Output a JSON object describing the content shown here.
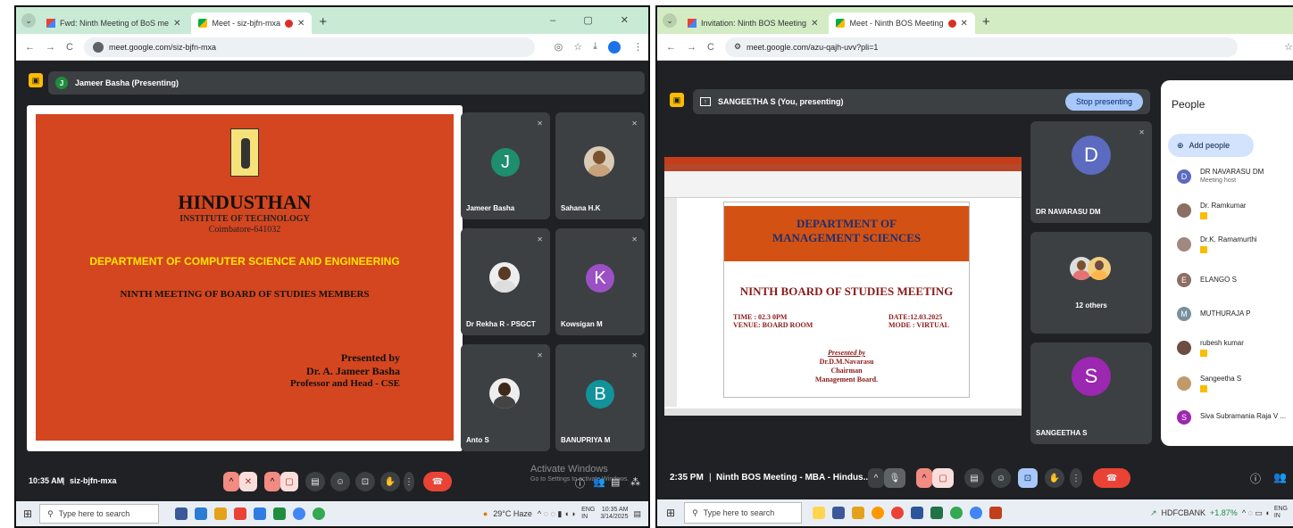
{
  "left": {
    "tabs": [
      {
        "label": "Fwd: Ninth Meeting of BoS me"
      },
      {
        "label": "Meet - siz-bjfn-mxa"
      }
    ],
    "url": "meet.google.com/siz-bjfn-mxa",
    "presenter": "Jameer Basha (Presenting)",
    "presenter_initial": "J",
    "slide": {
      "college": "HINDUSTHAN",
      "institute": "INSTITUTE OF TECHNOLOGY",
      "city": "Coimbatore-641032",
      "department": "DEPARTMENT OF COMPUTER SCIENCE AND ENGINEERING",
      "meeting": "NINTH MEETING OF BOARD OF STUDIES MEMBERS",
      "presented_by": "Presented by",
      "presenter_name": "Dr. A. Jameer Basha",
      "presenter_role": "Professor and Head - CSE",
      "background_color": "#d4461f"
    },
    "participants": [
      {
        "name": "Jameer Basha",
        "initial": "J",
        "color": "#1e8e6e",
        "type": "initial"
      },
      {
        "name": "Sahana H.K",
        "initial": "",
        "color": "#d9cbb6",
        "type": "photo"
      },
      {
        "name": "Dr Rekha R - PSGCT",
        "initial": "",
        "color": "#e8e8e8",
        "type": "photo"
      },
      {
        "name": "Kowsigan M",
        "initial": "K",
        "color": "#9b51c4",
        "type": "initial"
      },
      {
        "name": "Anto S",
        "initial": "",
        "color": "#e8e8e8",
        "type": "photo"
      },
      {
        "name": "BANUPRIYA M",
        "initial": "B",
        "color": "#12939a",
        "type": "initial"
      }
    ],
    "time": "10:35 AM",
    "meeting_code": "siz-bjfn-mxa",
    "activate_title": "Activate Windows",
    "activate_sub": "Go to Settings to activate Windows.",
    "taskbar": {
      "search_placeholder": "Type here to search",
      "weather": "29°C Haze",
      "lang": "ENG",
      "region": "IN",
      "clock_time": "10:35 AM",
      "clock_date": "3/14/2025"
    }
  },
  "right": {
    "tabs": [
      {
        "label": "Invitation: Ninth BOS Meeting"
      },
      {
        "label": "Meet - Ninth BOS Meeting"
      }
    ],
    "url": "meet.google.com/azu-qajh-uvv?pli=1",
    "presenter": "SANGEETHA S (You, presenting)",
    "stop_presenting": "Stop presenting",
    "slide": {
      "department_line1": "DEPARTMENT OF",
      "department_line2": "MANAGEMENT SCIENCES",
      "meeting": "NINTH BOARD OF STUDIES MEETING",
      "time": "TIME : 02.3 0PM",
      "venue": "VENUE: BOARD ROOM",
      "date": "DATE:12.03.2025",
      "mode": "MODE : VIRTUAL",
      "presented_by": "Presented by",
      "presenter_name": "Dr.D.M.Navarasu",
      "presenter_role": "Chairman",
      "presenter_board": "Management Board."
    },
    "tiles": [
      {
        "name": "DR NAVARASU DM",
        "initial": "D",
        "color": "#5c6bc0"
      },
      {
        "name": "12 others",
        "initial": "",
        "color": ""
      },
      {
        "name": "SANGEETHA S",
        "initial": "S",
        "color": "#9c27b0"
      }
    ],
    "people_title": "People",
    "add_people": "Add people",
    "people": [
      {
        "name": "DR NAVARASU DM",
        "sub": "Meeting host",
        "initial": "D",
        "color": "#5c6bc0"
      },
      {
        "name": "Dr. Ramkumar",
        "sub": "",
        "initial": "",
        "color": "#8d6e63"
      },
      {
        "name": "Dr.K. Ramamurthi",
        "sub": "",
        "initial": "",
        "color": "#a1887f"
      },
      {
        "name": "ELANGO S",
        "sub": "",
        "initial": "E",
        "color": "#8d6e63"
      },
      {
        "name": "MUTHURAJA P",
        "sub": "",
        "initial": "M",
        "color": "#78909c"
      },
      {
        "name": "rubesh kumar",
        "sub": "",
        "initial": "",
        "color": "#6d4c41"
      },
      {
        "name": "Sangeetha S",
        "sub": "",
        "initial": "",
        "color": "#c19a6b"
      },
      {
        "name": "Siva Subramania Raja V ...",
        "sub": "",
        "initial": "S",
        "color": "#9c27b0"
      }
    ],
    "time": "2:35 PM",
    "meeting_title": "Ninth BOS Meeting - MBA - Hindus...",
    "taskbar": {
      "search_placeholder": "Type here to search",
      "stock": "HDFCBANK",
      "stock_change": "+1.87%",
      "lang": "ENG",
      "region": "IN"
    }
  }
}
